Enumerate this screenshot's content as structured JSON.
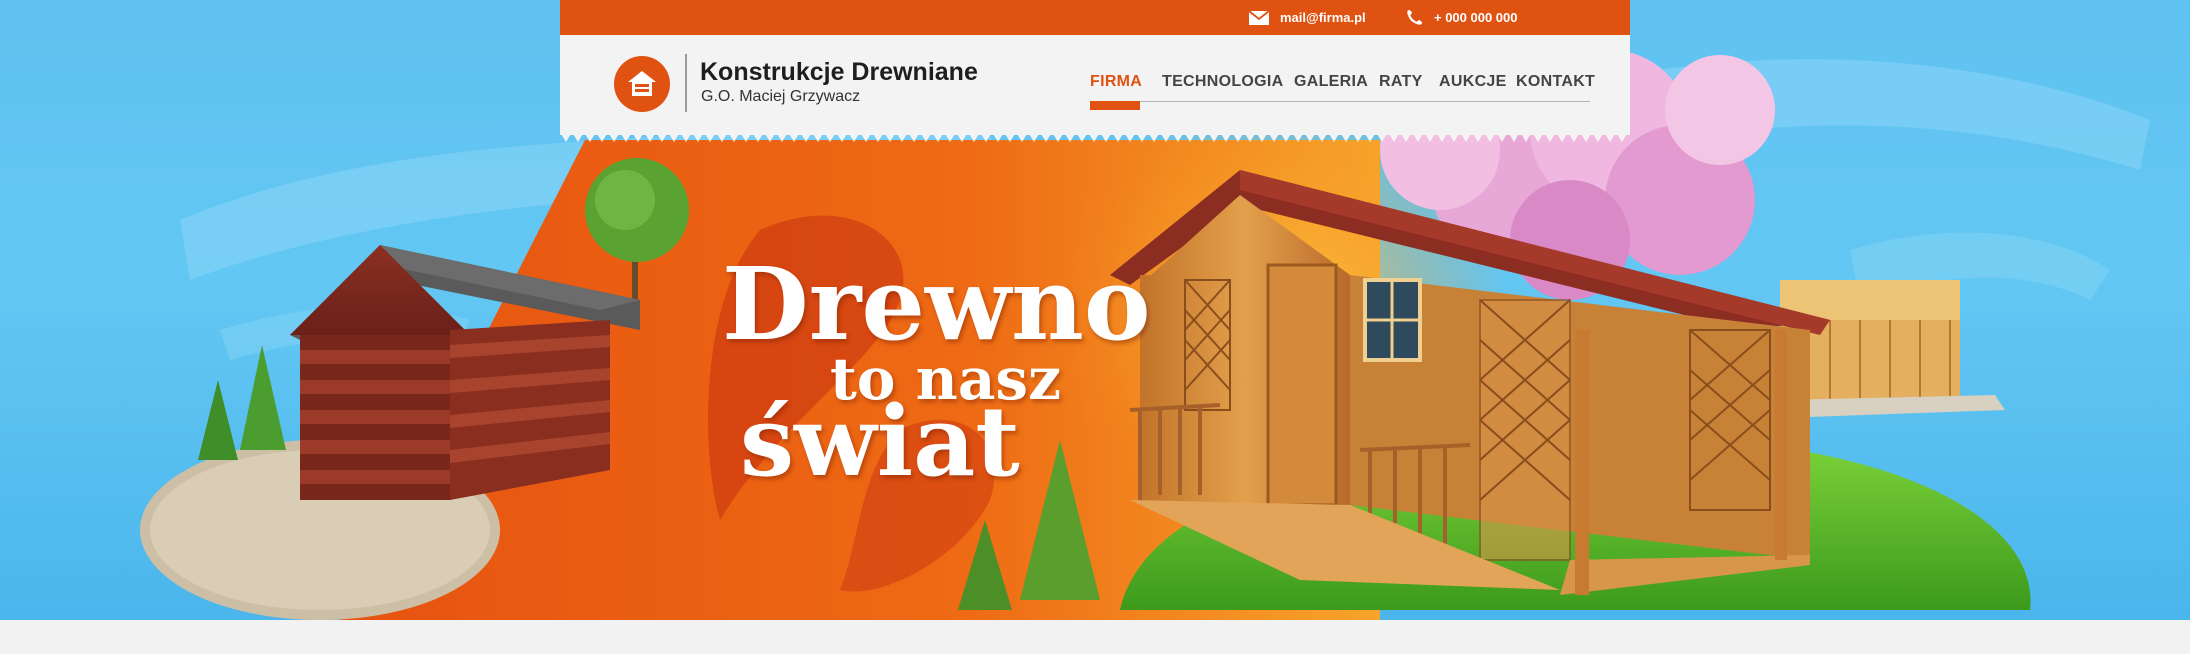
{
  "topbar": {
    "email": "mail@firma.pl",
    "phone": "+ 000 000 000",
    "mail_icon": "envelope-icon",
    "phone_icon": "phone-icon"
  },
  "brand": {
    "title": "Konstrukcje Drewniane",
    "subtitle": "G.O. Maciej Grzywacz",
    "logo_icon": "house-logo-icon"
  },
  "nav": {
    "items": [
      {
        "label": "FIRMA",
        "active": true
      },
      {
        "label": "TECHNOLOGIA",
        "active": false
      },
      {
        "label": "GALERIA",
        "active": false
      },
      {
        "label": "RATY",
        "active": false
      },
      {
        "label": "AUKCJE",
        "active": false
      },
      {
        "label": "KONTAKT",
        "active": false
      }
    ]
  },
  "hero": {
    "line1": "Drewno",
    "line2": "to nasz",
    "line3": "świat"
  },
  "colors": {
    "accent": "#e05212",
    "sky": "#5fc2f0",
    "header_bg": "#f3f3f3",
    "text_dark": "#1e1e1e"
  }
}
